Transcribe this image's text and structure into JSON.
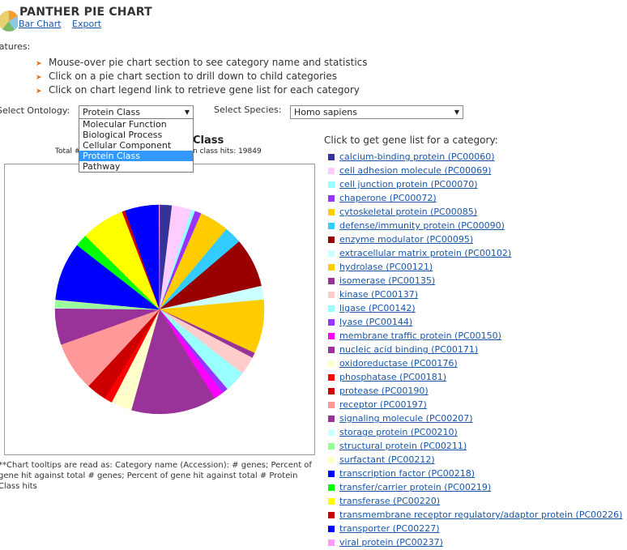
{
  "header": {
    "title": "PANTHER PIE CHART"
  },
  "nav": {
    "bar_chart": "Bar Chart",
    "export": "Export"
  },
  "features": {
    "label": "eatures:",
    "items": [
      "Mouse-over pie chart section to see category name and statistics",
      "Click on a pie chart section to drill down to child categories",
      "Click on chart legend link to retrieve gene list for each category"
    ]
  },
  "controls": {
    "ontology_label": "Select Ontology:",
    "ontology_value": "Protein Class",
    "ontology_options": [
      "Molecular Function",
      "Biological Process",
      "Cellular Component",
      "Protein Class",
      "Pathway"
    ],
    "species_label": "Select Species:",
    "species_value": "Homo sapiens"
  },
  "chart": {
    "title_fragment": "Class",
    "total_fragment": "Total #",
    "hits_fragment": "n class hits: 19849",
    "note": "**Chart tooltips are read as: Category name (Accession): # genes; Percent of gene hit against total # genes; Percent of gene hit against total # Protein Class hits"
  },
  "legend": {
    "title": "Click to get gene list for a category:",
    "items": [
      {
        "label": "calcium-binding protein (PC00060)",
        "color": "#333399"
      },
      {
        "label": "cell adhesion molecule (PC00069)",
        "color": "#ffccff"
      },
      {
        "label": "cell junction protein (PC00070)",
        "color": "#99ffff"
      },
      {
        "label": "chaperone (PC00072)",
        "color": "#9933ff"
      },
      {
        "label": "cytoskeletal protein (PC00085)",
        "color": "#ffcc00"
      },
      {
        "label": "defense/immunity protein (PC00090)",
        "color": "#33ccff"
      },
      {
        "label": "enzyme modulator (PC00095)",
        "color": "#990000"
      },
      {
        "label": "extracellular matrix protein (PC00102)",
        "color": "#ccffff"
      },
      {
        "label": "hydrolase (PC00121)",
        "color": "#ffcc00"
      },
      {
        "label": "isomerase (PC00135)",
        "color": "#993399"
      },
      {
        "label": "kinase (PC00137)",
        "color": "#ffcccc"
      },
      {
        "label": "ligase (PC00142)",
        "color": "#99ffff"
      },
      {
        "label": "lyase (PC00144)",
        "color": "#9933ff"
      },
      {
        "label": "membrane traffic protein (PC00150)",
        "color": "#ff00ff"
      },
      {
        "label": "nucleic acid binding (PC00171)",
        "color": "#993399"
      },
      {
        "label": "oxidoreductase (PC00176)",
        "color": "#ffffcc"
      },
      {
        "label": "phosphatase (PC00181)",
        "color": "#ff0000"
      },
      {
        "label": "protease (PC00190)",
        "color": "#cc0000"
      },
      {
        "label": "receptor (PC00197)",
        "color": "#ff9999"
      },
      {
        "label": "signaling molecule (PC00207)",
        "color": "#993399"
      },
      {
        "label": "storage protein (PC00210)",
        "color": "#ccffff"
      },
      {
        "label": "structural protein (PC00211)",
        "color": "#99ff99"
      },
      {
        "label": "surfactant (PC00212)",
        "color": "#ffffcc"
      },
      {
        "label": "transcription factor (PC00218)",
        "color": "#0000ff"
      },
      {
        "label": "transfer/carrier protein (PC00219)",
        "color": "#00ff00"
      },
      {
        "label": "transferase (PC00220)",
        "color": "#ffff00"
      },
      {
        "label": "transmembrane receptor regulatory/adaptor protein (PC00226)",
        "color": "#cc0000"
      },
      {
        "label": "transporter (PC00227)",
        "color": "#0000ff"
      },
      {
        "label": "viral protein (PC00237)",
        "color": "#ff99ff"
      }
    ]
  },
  "chart_data": {
    "type": "pie",
    "slices": [
      {
        "label": "calcium-binding protein (PC00060)",
        "value": 1.9,
        "color": "#333399"
      },
      {
        "label": "cell adhesion molecule (PC00069)",
        "value": 3.0,
        "color": "#ffccff"
      },
      {
        "label": "cell junction protein (PC00070)",
        "value": 0.6,
        "color": "#99ffff"
      },
      {
        "label": "chaperone (PC00072)",
        "value": 1.0,
        "color": "#9933ff"
      },
      {
        "label": "cytoskeletal protein (PC00085)",
        "value": 4.5,
        "color": "#ffcc00"
      },
      {
        "label": "defense/immunity protein (PC00090)",
        "value": 2.7,
        "color": "#33ccff"
      },
      {
        "label": "enzyme modulator (PC00095)",
        "value": 7.6,
        "color": "#990000"
      },
      {
        "label": "extracellular matrix protein (PC00102)",
        "value": 2.1,
        "color": "#ccffff"
      },
      {
        "label": "hydrolase (PC00121)",
        "value": 8.3,
        "color": "#ffcc00"
      },
      {
        "label": "isomerase (PC00135)",
        "value": 0.8,
        "color": "#993399"
      },
      {
        "label": "kinase (PC00137)",
        "value": 2.8,
        "color": "#ffcccc"
      },
      {
        "label": "ligase (PC00142)",
        "value": 3.3,
        "color": "#99ffff"
      },
      {
        "label": "lyase (PC00144)",
        "value": 0.9,
        "color": "#9933ff"
      },
      {
        "label": "membrane traffic protein (PC00150)",
        "value": 1.5,
        "color": "#ff00ff"
      },
      {
        "label": "nucleic acid binding (PC00171)",
        "value": 13.1,
        "color": "#993399"
      },
      {
        "label": "oxidoreductase (PC00176)",
        "value": 3.2,
        "color": "#ffffcc"
      },
      {
        "label": "phosphatase (PC00181)",
        "value": 1.2,
        "color": "#ff0000"
      },
      {
        "label": "protease (PC00190)",
        "value": 3.1,
        "color": "#cc0000"
      },
      {
        "label": "receptor (PC00197)",
        "value": 7.6,
        "color": "#ff9999"
      },
      {
        "label": "signaling molecule (PC00207)",
        "value": 5.6,
        "color": "#993399"
      },
      {
        "label": "storage protein (PC00210)",
        "value": 0.1,
        "color": "#ccffff"
      },
      {
        "label": "structural protein (PC00211)",
        "value": 1.1,
        "color": "#99ff99"
      },
      {
        "label": "surfactant (PC00212)",
        "value": 0.1,
        "color": "#ffffcc"
      },
      {
        "label": "transcription factor (PC00218)",
        "value": 9.0,
        "color": "#0000ff"
      },
      {
        "label": "transfer/carrier protein (PC00219)",
        "value": 1.9,
        "color": "#00ff00"
      },
      {
        "label": "transferase (PC00220)",
        "value": 6.7,
        "color": "#ffff00"
      },
      {
        "label": "transmembrane receptor regulatory/adaptor protein (PC00226)",
        "value": 0.5,
        "color": "#cc0000"
      },
      {
        "label": "transporter (PC00227)",
        "value": 5.2,
        "color": "#0000ff"
      },
      {
        "label": "viral protein (PC00237)",
        "value": 0.1,
        "color": "#ff99ff"
      }
    ]
  }
}
